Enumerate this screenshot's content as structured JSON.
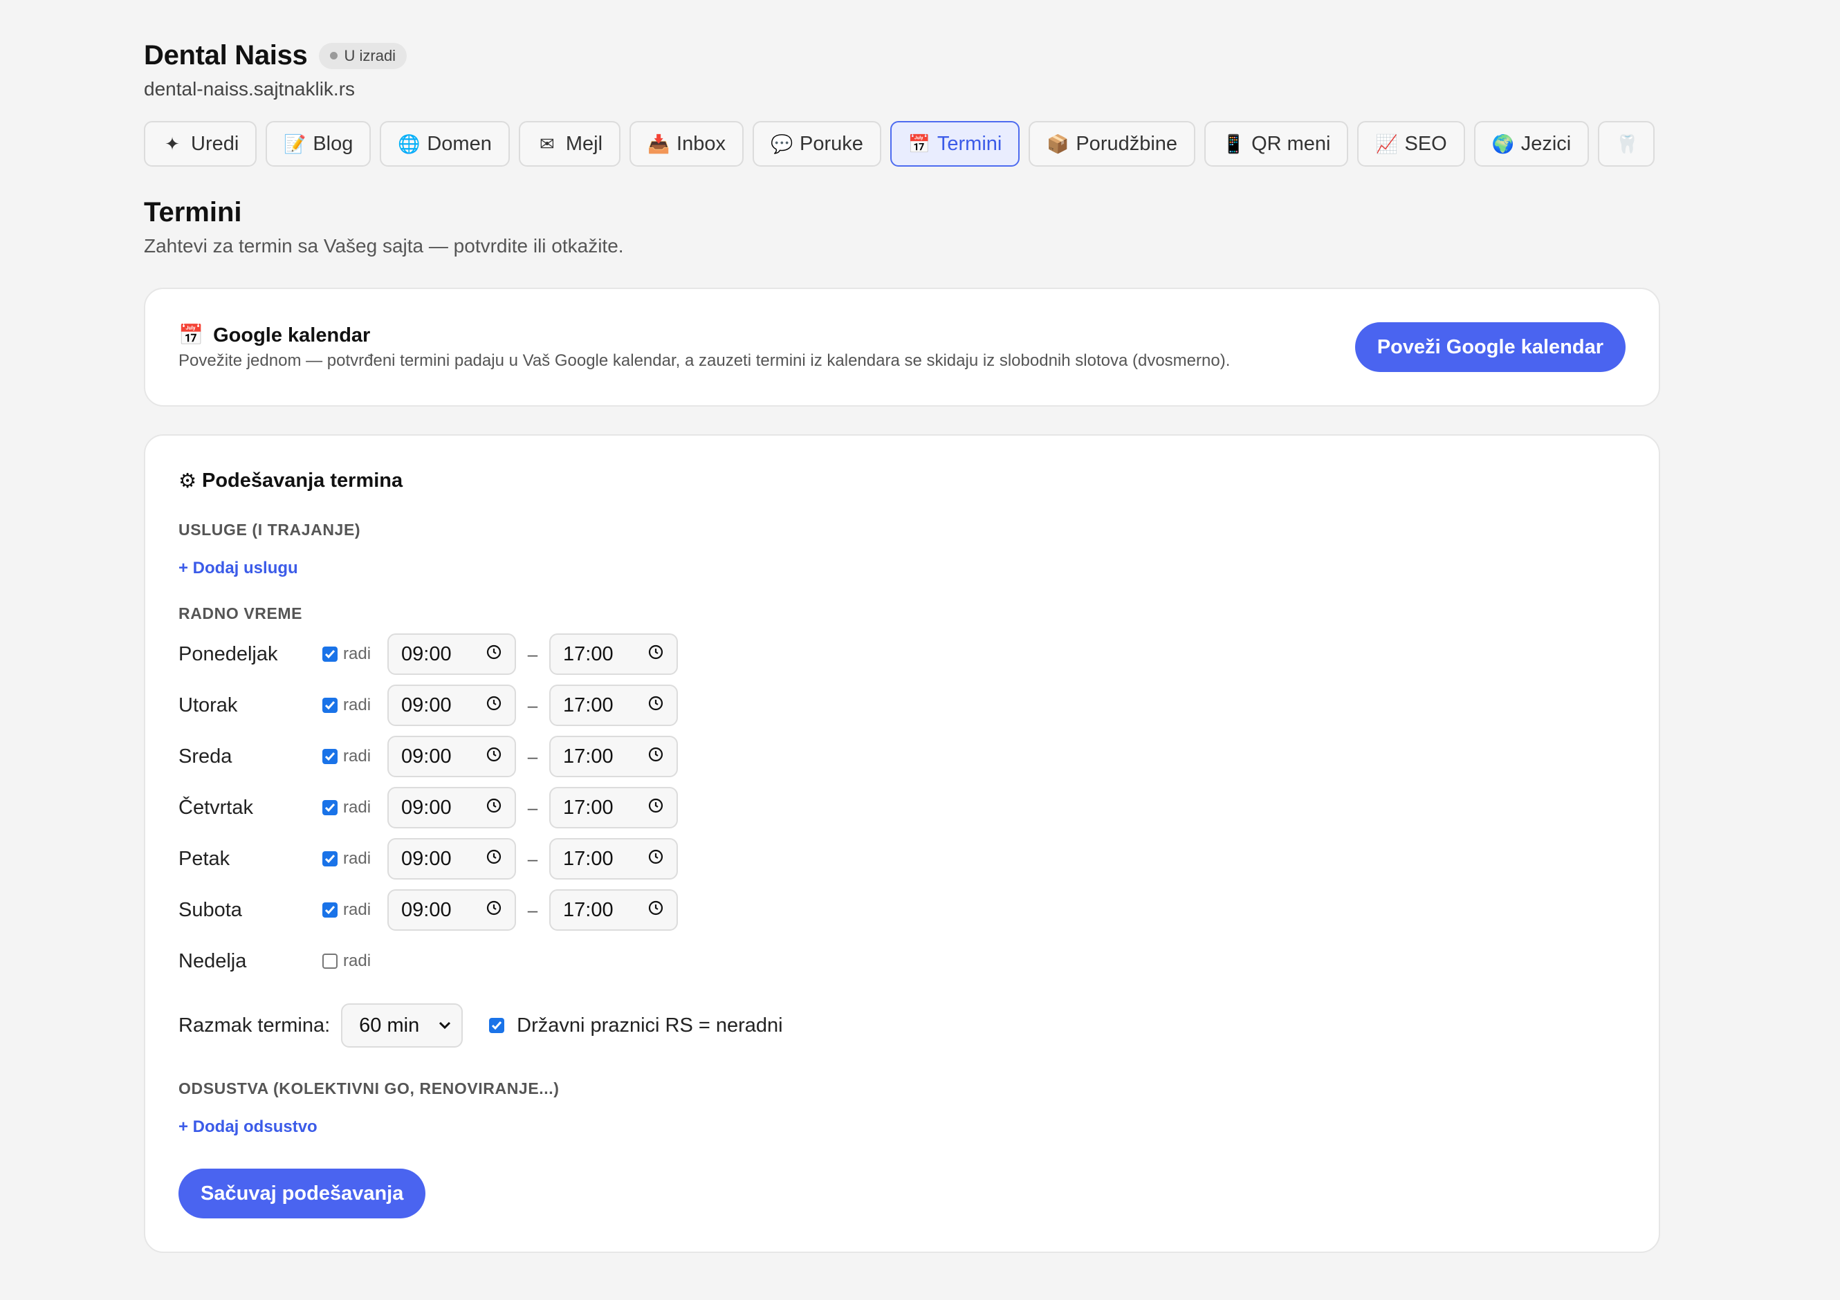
{
  "site": {
    "title": "Dental Naiss",
    "status": "U izradi",
    "url": "dental-naiss.sajtnaklik.rs"
  },
  "tabs": [
    {
      "label": "Uredi",
      "icon": "sparkle-icon",
      "glyph": "✦",
      "active": false
    },
    {
      "label": "Blog",
      "icon": "memo-icon",
      "glyph": "📝",
      "active": false
    },
    {
      "label": "Domen",
      "icon": "globe-icon",
      "glyph": "🌐",
      "active": false
    },
    {
      "label": "Mejl",
      "icon": "envelope-icon",
      "glyph": "✉",
      "active": false
    },
    {
      "label": "Inbox",
      "icon": "inbox-tray-icon",
      "glyph": "📥",
      "active": false
    },
    {
      "label": "Poruke",
      "icon": "speech-bubble-icon",
      "glyph": "💬",
      "active": false
    },
    {
      "label": "Termini",
      "icon": "calendar-icon",
      "glyph": "📅",
      "active": true
    },
    {
      "label": "Porudžbine",
      "icon": "package-icon",
      "glyph": "📦",
      "active": false
    },
    {
      "label": "QR meni",
      "icon": "mobile-phone-icon",
      "glyph": "📱",
      "active": false
    },
    {
      "label": "SEO",
      "icon": "chart-up-icon",
      "glyph": "📈",
      "active": false
    },
    {
      "label": "Jezici",
      "icon": "earth-icon",
      "glyph": "🌍",
      "active": false
    },
    {
      "label": "",
      "icon": "tooth-icon",
      "glyph": "🦷",
      "active": false
    }
  ],
  "page": {
    "title": "Termini",
    "subtitle": "Zahtevi za termin sa Vašeg sajta — potvrdite ili otkažite."
  },
  "google": {
    "title": "Google kalendar",
    "description": "Povežite jednom — potvrđeni termini padaju u Vaš Google kalendar, a zauzeti termini iz kalendara se skidaju iz slobodnih slotova (dvosmerno).",
    "button": "Poveži Google kalendar"
  },
  "settings": {
    "title": "Podešavanja termina",
    "services_label": "Usluge (i trajanje)",
    "add_service": "+ Dodaj uslugu",
    "hours_label": "Radno vreme",
    "works_label": "radi",
    "days": [
      {
        "name": "Ponedeljak",
        "works": true,
        "from": "09:00",
        "to": "17:00"
      },
      {
        "name": "Utorak",
        "works": true,
        "from": "09:00",
        "to": "17:00"
      },
      {
        "name": "Sreda",
        "works": true,
        "from": "09:00",
        "to": "17:00"
      },
      {
        "name": "Četvrtak",
        "works": true,
        "from": "09:00",
        "to": "17:00"
      },
      {
        "name": "Petak",
        "works": true,
        "from": "09:00",
        "to": "17:00"
      },
      {
        "name": "Subota",
        "works": true,
        "from": "09:00",
        "to": "17:00"
      },
      {
        "name": "Nedelja",
        "works": false,
        "from": "",
        "to": ""
      }
    ],
    "dash": "–",
    "interval_label": "Razmak termina:",
    "interval_value": "60 min",
    "holidays_label": "Državni praznici RS = neradni",
    "holidays_checked": true,
    "absence_label": "Odsustva (kolektivni GO, renoviranje...)",
    "add_absence": "+ Dodaj odsustvo",
    "save": "Sačuvaj podešavanja"
  }
}
